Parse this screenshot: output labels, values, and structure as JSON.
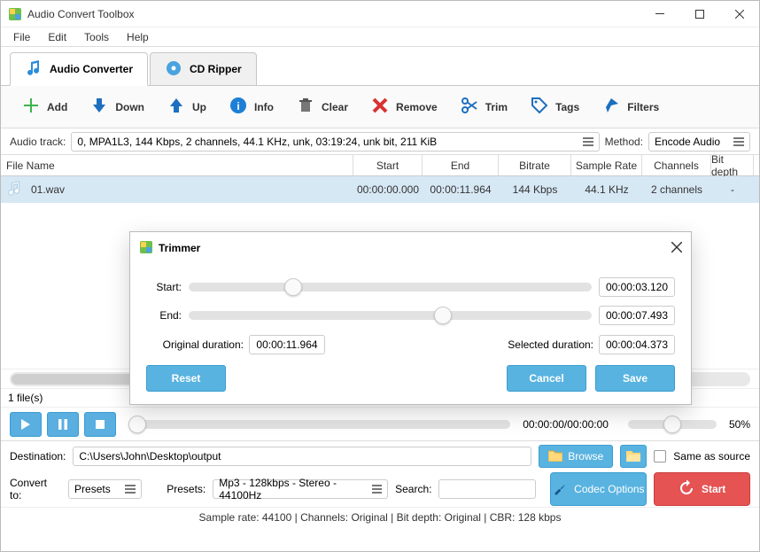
{
  "window": {
    "title": "Audio Convert Toolbox"
  },
  "menu": {
    "file": "File",
    "edit": "Edit",
    "tools": "Tools",
    "help": "Help"
  },
  "tabs": {
    "audio_converter": "Audio Converter",
    "cd_ripper": "CD Ripper"
  },
  "toolbar": {
    "add": "Add",
    "down": "Down",
    "up": "Up",
    "info": "Info",
    "clear": "Clear",
    "remove": "Remove",
    "trim": "Trim",
    "tags": "Tags",
    "filters": "Filters"
  },
  "trackrow": {
    "audio_track_label": "Audio track:",
    "track_value": "0, MPA1L3, 144 Kbps, 2 channels, 44.1 KHz, unk, 03:19:24, unk bit, 211 KiB",
    "method_label": "Method:",
    "method_value": "Encode Audio"
  },
  "table": {
    "headers": {
      "filename": "File Name",
      "start": "Start",
      "end": "End",
      "bitrate": "Bitrate",
      "sample_rate": "Sample Rate",
      "channels": "Channels",
      "bitdepth": "Bit depth"
    },
    "rows": [
      {
        "filename": "01.wav",
        "start": "00:00:00.000",
        "end": "00:00:11.964",
        "bitrate": "144 Kbps",
        "sample_rate": "44.1 KHz",
        "channels": "2 channels",
        "bitdepth": "-"
      }
    ]
  },
  "trimmer": {
    "title": "Trimmer",
    "start_label": "Start:",
    "start_value": "00:00:03.120",
    "end_label": "End:",
    "end_value": "00:00:07.493",
    "original_duration_label": "Original duration:",
    "original_duration_value": "00:00:11.964",
    "selected_duration_label": "Selected duration:",
    "selected_duration_value": "00:00:04.373",
    "reset": "Reset",
    "cancel": "Cancel",
    "save": "Save",
    "start_pct": 26,
    "end_pct": 63
  },
  "filecount": "1 file(s)",
  "player": {
    "time": "00:00:00/00:00:00",
    "volume": "50%",
    "volume_pct": 50
  },
  "destination": {
    "label": "Destination:",
    "value": "C:\\Users\\John\\Desktop\\output",
    "browse": "Browse",
    "same_as_source": "Same as source"
  },
  "convert": {
    "convert_to_label": "Convert to:",
    "convert_to_value": "Presets",
    "presets_label": "Presets:",
    "presets_value": "Mp3 - 128kbps - Stereo - 44100Hz",
    "search_label": "Search:",
    "codec_options": "Codec Options",
    "start": "Start"
  },
  "info_line": "Sample rate: 44100 | Channels: Original | Bit depth: Original | CBR: 128 kbps"
}
